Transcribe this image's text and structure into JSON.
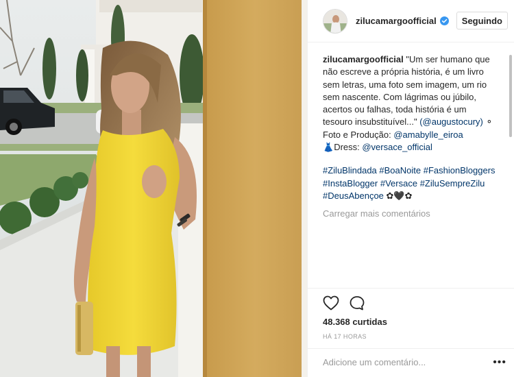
{
  "post": {
    "username": "zilucamargoofficial",
    "verified": true,
    "follow_button": "Seguindo",
    "photo_alt": "Woman in yellow dress leaning on a wall"
  },
  "caption": {
    "username": "zilucamargoofficial",
    "lines": [
      "\"Um ser humano que",
      "não escreve a própria história, é um livro",
      "sem letras, uma foto sem imagem, um rio",
      "sem nascente. Com lágrimas ou júbilo,",
      "acertos ou falhas, toda história é um",
      "tesouro insubstituível...\" ",
      "Foto e Produção: ",
      "Dress: "
    ],
    "mention_cury": "(@augustocury)",
    "cury_trailing": " ⚬",
    "mention_amabylle": "@amabylle_eiroa",
    "dress_icon": "👗",
    "mention_versace": "@versace_official"
  },
  "hashtags": {
    "line1": [
      "#ZiluBlindada",
      "#BoaNoite",
      "#FashionBloggers"
    ],
    "line2": [
      "#InstaBlogger",
      "#Versace",
      "#ZiluSempreZilu"
    ],
    "line3_tag": "#DeusAbençoe",
    "line3_emoji": " ✿🖤✿"
  },
  "load_more": "Carregar mais comentários",
  "likes": "48.368 curtidas",
  "timestamp": "HÁ 17 HORAS",
  "comment_placeholder": "Adicione um comentário...",
  "more_options": "•••",
  "icons": {
    "like": "heart-icon",
    "comment": "comment-bubble-icon",
    "verified": "verified-badge-icon",
    "options": "more-options-icon"
  },
  "colors": {
    "link": "#003569",
    "verified": "#3897f0",
    "muted": "#999999",
    "dress": "#f2d834"
  }
}
